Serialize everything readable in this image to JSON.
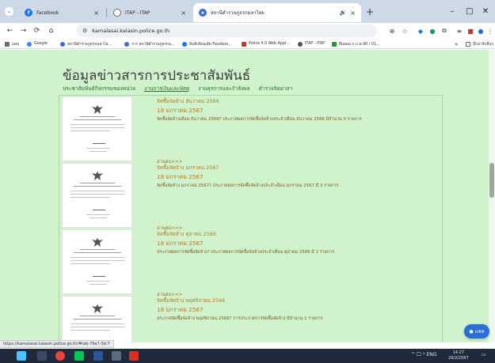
{
  "browser": {
    "tabs": [
      {
        "label": "Facebook",
        "active": false,
        "icon": "facebook-icon",
        "color": "#1877f2"
      },
      {
        "label": "ITAP - ITAP",
        "active": false,
        "icon": "itap-icon",
        "color": "#555555"
      },
      {
        "label": "สถานีตำรวจภูธรกมลาไสย",
        "active": true,
        "icon": "police-site-icon",
        "color": "#3d6fc7"
      }
    ],
    "address": "kamalasai.kalasin.police.go.th",
    "bookmarks": [
      {
        "label": "แผน",
        "icon": "grid-icon",
        "color": "#6b6b6b"
      },
      {
        "label": "Google",
        "icon": "google-icon",
        "color": "#4285f4"
      },
      {
        "label": "สถานีตำรวจภูธรกมลาไส...",
        "icon": "police-site-icon",
        "color": "#3d6fc7"
      },
      {
        "label": "<< สถานีตำรวจภูธรกม...",
        "icon": "police-site-icon",
        "color": "#3d6fc7"
      },
      {
        "label": "อินทิเลียนเต้ต Faceboo...",
        "icon": "facebook-icon",
        "color": "#1877f2"
      },
      {
        "label": "Police 4.0 Web Appl...",
        "icon": "police40-icon",
        "color": "#c0392b"
      },
      {
        "label": "ITAP - ITAP",
        "icon": "itap-icon",
        "color": "#555555"
      },
      {
        "label": "ยืนยอน ก.ก.ต.90 / 01...",
        "icon": "doc-icon",
        "color": "#2f8f3a"
      }
    ],
    "bookmarks_overflow": "»",
    "other_bookmarks": "บุ๊กมาร์กอื่นๆ"
  },
  "page": {
    "title": "ข้อมูลข่าวสารการประชาสัมพันธ์",
    "subnav": [
      {
        "label": "ประชาสัมพันธ์กิจกรรมของหน่วย",
        "active": false
      },
      {
        "label": "งานการเงินและพัสดุ",
        "active": true
      },
      {
        "label": "งานธุรการและกำลังพล",
        "active": false
      },
      {
        "label": "ตำรวจจิตอาสา",
        "active": false
      }
    ],
    "posts": [
      {
        "readmore": "",
        "title": "จัดซื้อจัดจ้าง ธันวาคม 2566",
        "date": "18 มกราคม 2567",
        "desc": "จัดซื้อจัดจ้างเดือน ธันวาคม 2566? ประกาศผลการจัดซื้อจัดจ้างประจำเดือน ธันวาคม 2566 มีจำนวน 3 รายการ"
      },
      {
        "readmore": "อ่านต่อ>>>",
        "title": "จัดซื้อจัดจ้าง มกราคม 2567",
        "date": "18 มกราคม 2567",
        "desc": "จัดซื้อจัดจ้าง มกราคม 2567? ประกาศผลการจัดซื้อจัดจ้างประจำเดือน มกราคม 2567 มี 3 รายการ"
      },
      {
        "readmore": "อ่านต่อ>>>",
        "title": "จัดซื้อจัดจ้าง ตุลาคม 2566",
        "date": "18 มกราคม 2567",
        "desc": "ประกาศผลการจัดซื้อจัดจ้าง? ประกาศผลการจัดซื้อจัดจ้างประจำเดือน ตุลาคม 2566 มี 1 รายการ"
      },
      {
        "readmore": "อ่านต่อ>>>",
        "title": "จัดซื้อจัดจ้าง พฤศจิกายน 2566",
        "date": "18 มกราคม 2567",
        "desc": "ประกาศจัดซื้อจัดจ้าง พฤศจิกายน 2566? การประกาศการจัดซื้อจัดจ้าง มีจำนวน 1 รายการ"
      }
    ],
    "chat_label": "แชท",
    "status_url": "https://kamalasai.kalasin.police.go.th/#tab-79a7-3d-7"
  },
  "taskbar": {
    "apps": [
      {
        "icon": "windows-start-icon",
        "color": "#4cc2ff"
      },
      {
        "icon": "search-icon",
        "color": "#3a4a63"
      },
      {
        "icon": "chrome-icon",
        "color": "#e8453c"
      },
      {
        "icon": "line-icon",
        "color": "#06c755"
      },
      {
        "icon": "word-icon",
        "color": "#2b579a"
      },
      {
        "icon": "camera-icon",
        "color": "#5b6b82"
      },
      {
        "icon": "pdf-icon",
        "color": "#d93025"
      }
    ],
    "tray_text": "^ 🖵 ⁽⁾ ENG",
    "time": "14:27",
    "date": "29/2/2567"
  },
  "colors": {
    "page_bg": "#d0f2cc",
    "accent_text": "#c07a18",
    "nav_link": "#2a6f2a"
  }
}
